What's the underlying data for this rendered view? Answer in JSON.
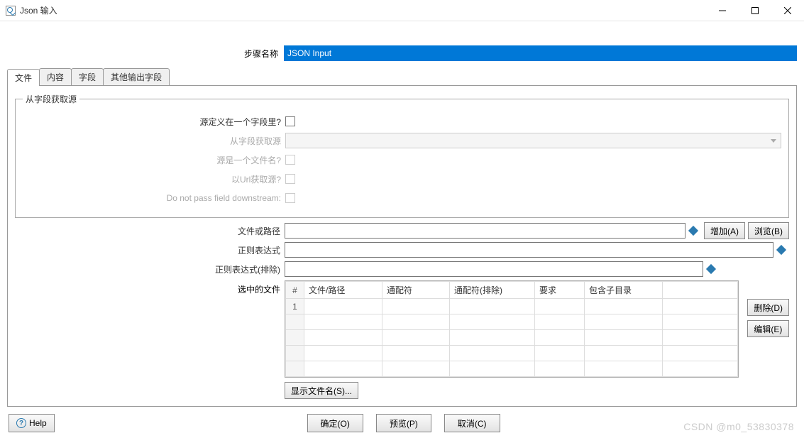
{
  "window": {
    "title": "Json 输入"
  },
  "step": {
    "label": "步骤名称",
    "value": "JSON Input"
  },
  "tabs": {
    "file": "文件",
    "content": "内容",
    "fields": "字段",
    "other": "其他输出字段"
  },
  "group": {
    "legend": "从字段获取源"
  },
  "rows": {
    "sourceInField": "源定义在一个字段里?",
    "getFromField": "从字段获取源",
    "sourceIsFilename": "源是一个文件名?",
    "getFromUrl": "以Url获取源?",
    "doNotPass": "Do not pass field downstream:",
    "fileOrPath": "文件或路径",
    "regex": "正则表达式",
    "regexExclude": "正则表达式(排除)",
    "selectedFiles": "选中的文件"
  },
  "buttons": {
    "add": "增加(A)",
    "browse": "浏览(B)",
    "delete": "删除(D)",
    "edit": "编辑(E)",
    "showFilenames": "显示文件名(S)...",
    "ok": "确定(O)",
    "preview": "预览(P)",
    "cancel": "取消(C)",
    "help": "Help"
  },
  "table": {
    "headers": {
      "num": "#",
      "path": "文件/路径",
      "wildcard": "通配符",
      "wildcardExclude": "通配符(排除)",
      "required": "要求",
      "includeSubdir": "包含子目录"
    },
    "rows": [
      {
        "num": "1",
        "path": "",
        "wildcard": "",
        "wildcardExclude": "",
        "required": "",
        "includeSubdir": ""
      }
    ]
  },
  "watermark": "CSDN @m0_53830378"
}
